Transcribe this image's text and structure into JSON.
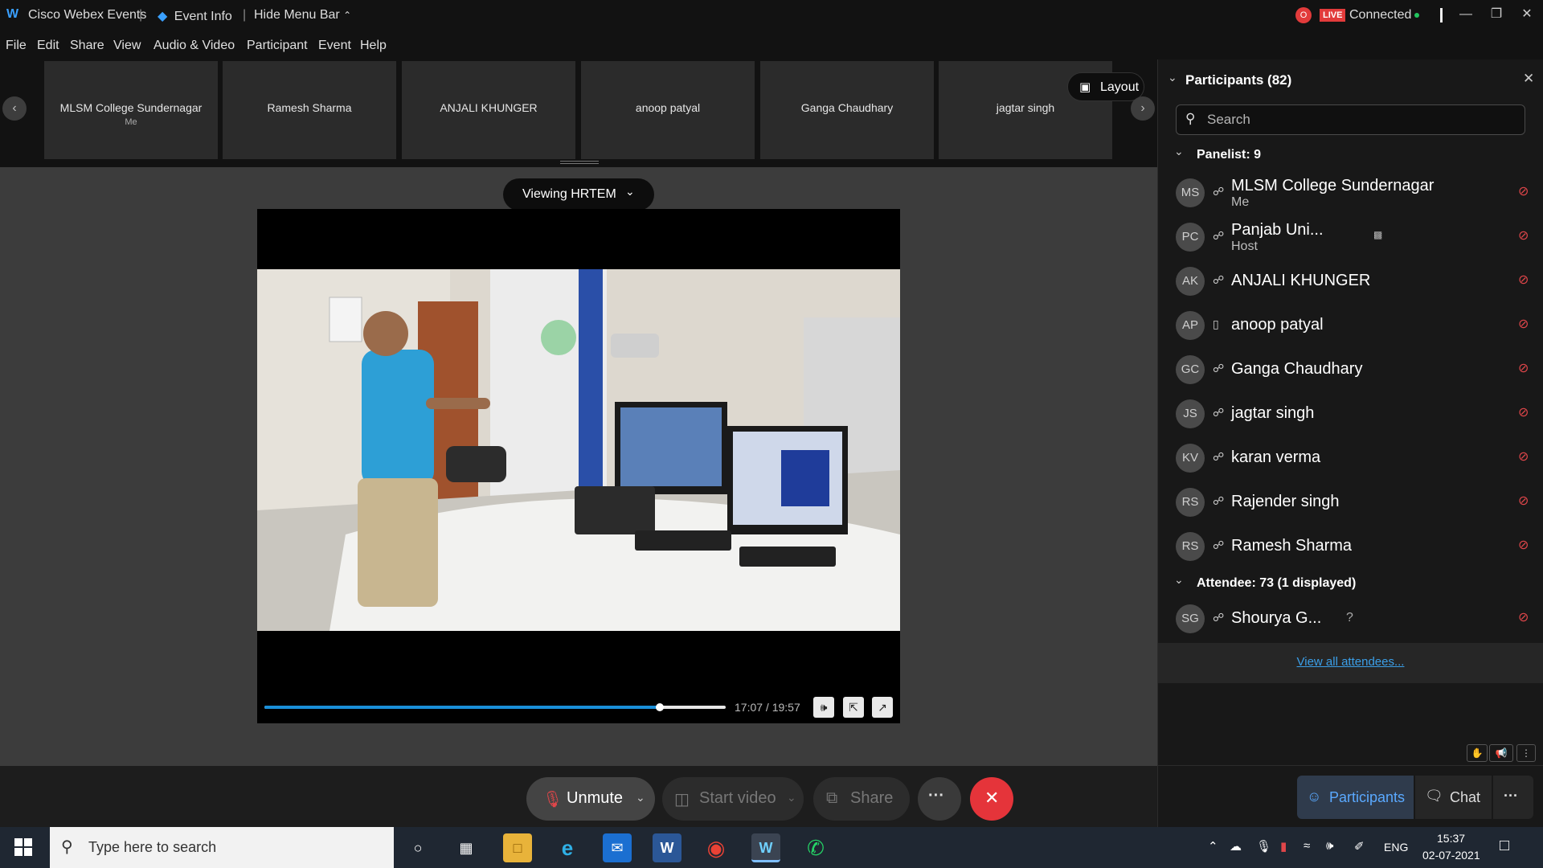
{
  "titlebar": {
    "app_name": "Cisco Webex Events",
    "event_info": "Event Info",
    "hide_menu_bar": "Hide Menu Bar",
    "live_badge": "LIVE",
    "status": "Connected"
  },
  "menu": [
    "File",
    "Edit",
    "Share",
    "View",
    "Audio & Video",
    "Participant",
    "Event",
    "Help"
  ],
  "filmstrip": {
    "tiles": [
      {
        "name": "MLSM College Sundernagar",
        "sub": "Me"
      },
      {
        "name": "Ramesh Sharma",
        "sub": ""
      },
      {
        "name": "ANJALI KHUNGER",
        "sub": ""
      },
      {
        "name": "anoop patyal",
        "sub": ""
      },
      {
        "name": "Ganga Chaudhary",
        "sub": ""
      },
      {
        "name": "jagtar singh",
        "sub": ""
      }
    ],
    "layout_label": "Layout"
  },
  "stage": {
    "viewing_label": "Viewing HRTEM",
    "video_time": "17:07 / 19:57",
    "progress_fraction": 0.857
  },
  "controls": {
    "unmute": "Unmute",
    "start_video": "Start video",
    "share": "Share",
    "more": "···"
  },
  "panel": {
    "title": "Participants (82)",
    "search_placeholder": "Search",
    "panelist_header": "Panelist: 9",
    "attendee_header": "Attendee: 73 (1 displayed)",
    "panelists": [
      {
        "initials": "MS",
        "name": "MLSM College Sundernagar",
        "role": "Me"
      },
      {
        "initials": "PC",
        "name": "Panjab Uni...",
        "role": "Host"
      },
      {
        "initials": "AK",
        "name": "ANJALI KHUNGER",
        "role": ""
      },
      {
        "initials": "AP",
        "name": "anoop patyal",
        "role": ""
      },
      {
        "initials": "GC",
        "name": "Ganga Chaudhary",
        "role": ""
      },
      {
        "initials": "JS",
        "name": "jagtar singh",
        "role": ""
      },
      {
        "initials": "KV",
        "name": "karan verma",
        "role": ""
      },
      {
        "initials": "RS",
        "name": "Rajender singh",
        "role": ""
      },
      {
        "initials": "RS",
        "name": "Ramesh Sharma",
        "role": ""
      }
    ],
    "attendees": [
      {
        "initials": "SG",
        "name": "Shourya G...",
        "role": ""
      }
    ],
    "unknown_mark": "?",
    "view_all": "View all attendees...",
    "footer": {
      "participants": "Participants",
      "chat": "Chat"
    }
  },
  "taskbar": {
    "search_placeholder": "Type here to search",
    "language": "ENG",
    "time": "15:37",
    "date": "02-07-2021"
  }
}
